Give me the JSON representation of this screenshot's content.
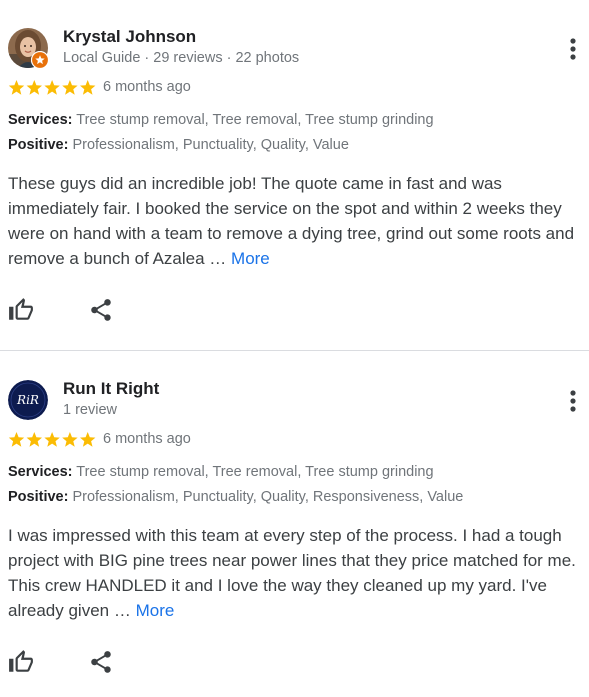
{
  "reviews": [
    {
      "name": "Krystal Johnson",
      "meta": "Local Guide · 29 reviews · 22 photos",
      "rating": 5,
      "date": "6 months ago",
      "services_label": "Services:",
      "services_value": "Tree stump removal, Tree removal, Tree stump grinding",
      "positive_label": "Positive:",
      "positive_value": "Professionalism, Punctuality, Quality, Value",
      "text": "These guys did an incredible job! The quote came in fast and was immediately fair. I booked the service on the spot and within 2 weeks they were on hand with a team to remove a dying tree, grind out some roots and remove a bunch of Azalea … ",
      "more": "More"
    },
    {
      "name": "Run It Right",
      "meta": "1 review",
      "rating": 5,
      "date": "6 months ago",
      "services_label": "Services:",
      "services_value": "Tree stump removal, Tree removal, Tree stump grinding",
      "positive_label": "Positive:",
      "positive_value": "Professionalism, Punctuality, Quality, Responsiveness, Value",
      "text": "I was impressed with this team at every step of the process. I had a tough project with BIG pine trees near power lines that they price matched for me. This crew HANDLED it and I love the way they cleaned up my yard. I've already given … ",
      "more": "More",
      "avatar_logo": "RiR"
    }
  ],
  "colors": {
    "star": "#fbbc04",
    "link": "#1a73e8",
    "secondary_text": "#70757a",
    "guide_badge": "#e8710a",
    "avatar_2_bg": "#0d1b4f"
  },
  "icons": {
    "menu": "more-vert-icon",
    "like": "thumb-up-icon",
    "share": "share-icon",
    "star": "star-icon",
    "badge": "local-guide-badge-icon"
  }
}
